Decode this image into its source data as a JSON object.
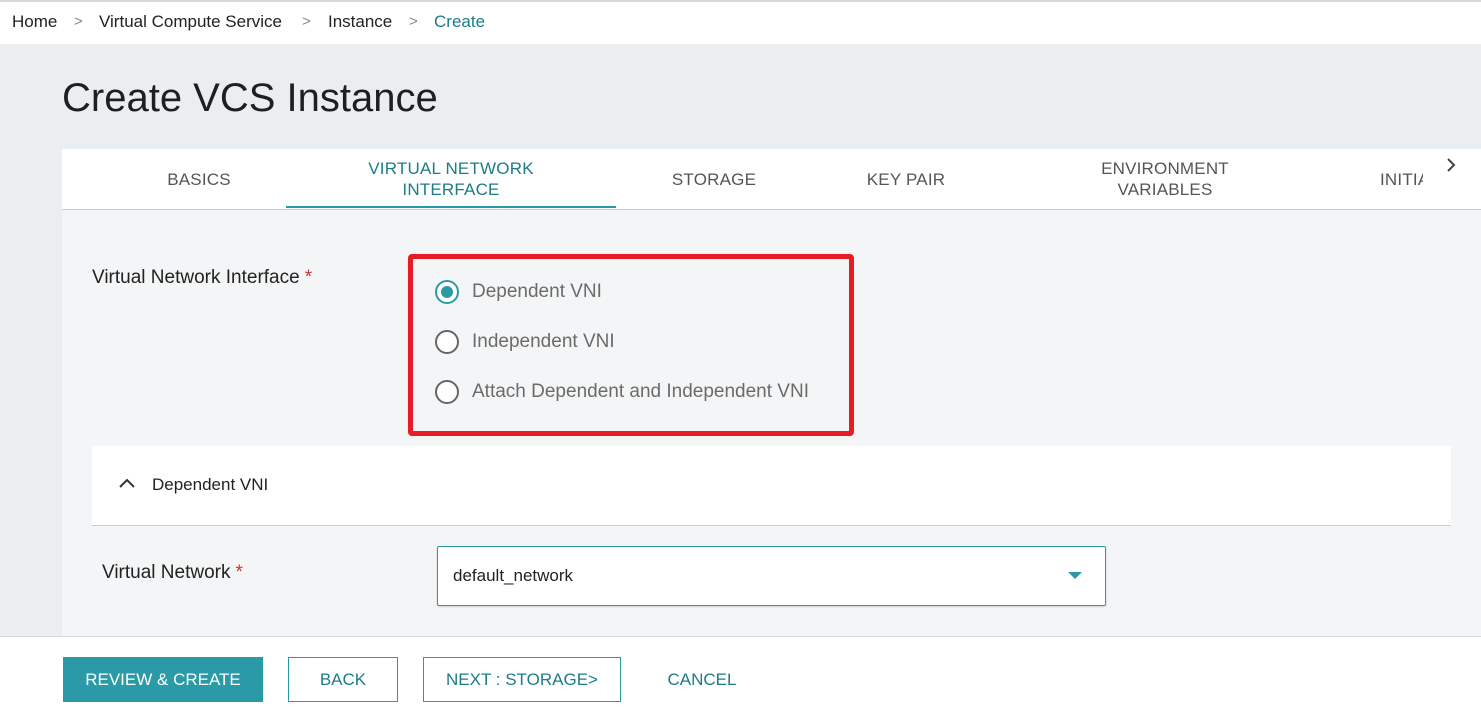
{
  "breadcrumb": {
    "items": [
      "Home",
      "Virtual Compute Service",
      "Instance",
      "Create"
    ],
    "separator": ">"
  },
  "page": {
    "title": "Create VCS Instance"
  },
  "tabs": [
    {
      "line1": "BASICS",
      "line2": ""
    },
    {
      "line1": "VIRTUAL NETWORK",
      "line2": "INTERFACE"
    },
    {
      "line1": "STORAGE",
      "line2": ""
    },
    {
      "line1": "KEY PAIR",
      "line2": ""
    },
    {
      "line1": "ENVIRONMENT",
      "line2": "VARIABLES"
    },
    {
      "line1": "INITIA",
      "line2": ""
    }
  ],
  "active_tab": "VIRTUAL NETWORK INTERFACE",
  "vni": {
    "label": "Virtual Network Interface",
    "required_mark": "*",
    "options": [
      "Dependent VNI",
      "Independent VNI",
      "Attach Dependent and Independent VNI"
    ],
    "selected": "Dependent VNI"
  },
  "dependent_section": {
    "title": "Dependent VNI",
    "expanded": true,
    "virtual_network_label": "Virtual Network",
    "required_mark": "*",
    "virtual_network_value": "default_network"
  },
  "footer": {
    "review_create": "REVIEW & CREATE",
    "back": "BACK",
    "next": "NEXT : STORAGE>",
    "cancel": "CANCEL"
  },
  "colors": {
    "accent": "#2a9aa6",
    "accent_text": "#1c7c88",
    "highlight_border": "#e81c24",
    "required": "#d0312d"
  },
  "icons": {
    "tab_scroll": "chevron-right-icon",
    "accordion_toggle": "chevron-up-icon",
    "select_caret": "caret-down-icon"
  }
}
